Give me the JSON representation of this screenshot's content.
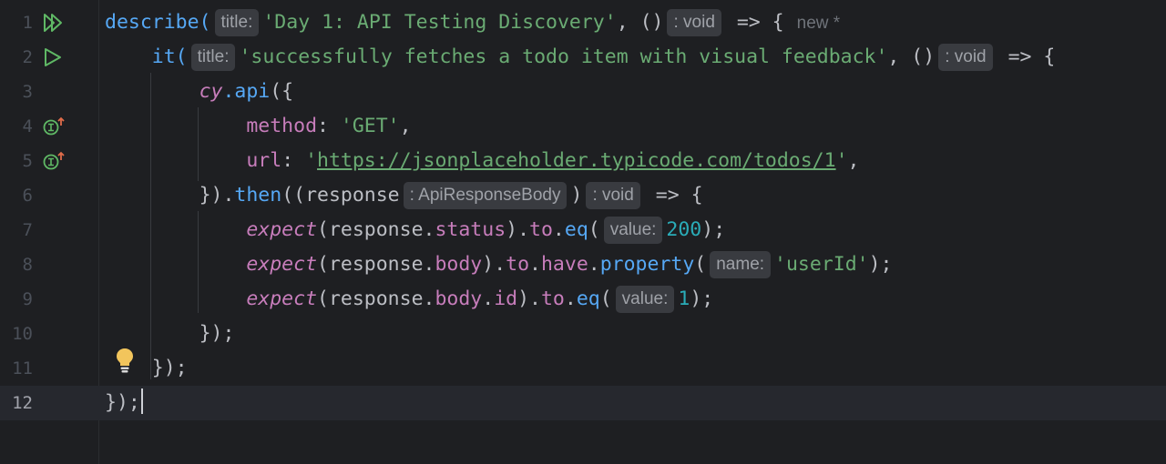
{
  "editor": {
    "line_numbers": [
      "1",
      "2",
      "3",
      "4",
      "5",
      "6",
      "7",
      "8",
      "9",
      "10",
      "11",
      "12"
    ],
    "current_line": 12,
    "hints": {
      "title1": "title:",
      "void1": ": void",
      "new_inlay": "new *",
      "title2": "title:",
      "void2": ": void",
      "api_response": ": ApiResponseBody",
      "void3": ": void",
      "value1": "value:",
      "name": "name:",
      "value2": "value:"
    },
    "tokens": {
      "describe": "describe(",
      "suite_name": "'Day 1: API Testing Discovery'",
      "comma_paren": ", ()",
      "arrow_open": " => {",
      "it": "it(",
      "test_name": "'successfully fetches a todo item with visual feedback'",
      "cy": "cy",
      "dot_api": ".api",
      "open_obj": "({",
      "method_key": "method",
      "colon": ": ",
      "method_val": "'GET'",
      "comma": ",",
      "url_key": "url",
      "quote": "'",
      "url_val": "https://jsonplaceholder.typicode.com/todos/1",
      "close_then_pre": "}).",
      "then": "then",
      "then_args": "((response",
      "close_paren": ")",
      "expect": "expect",
      "response": "(response.",
      "status": "status",
      "to": "to",
      "eq": "eq",
      "paren_open": "(",
      "num200": "200",
      "close_semi": ");",
      "body": "body",
      "have": "have",
      "property": "property",
      "userId": "'userId'",
      "id": "id",
      "num1": "1",
      "close_block": "});",
      "dot": ".",
      "close_paren_dot": ")."
    }
  },
  "colors": {
    "background": "#1e1f22",
    "keyword": "#56a8f5",
    "string": "#6aab73",
    "property": "#c77dbb",
    "number": "#2aacb8"
  },
  "icons": [
    "run-suite-icon",
    "run-test-icon",
    "implements-icon",
    "lightbulb-icon"
  ]
}
